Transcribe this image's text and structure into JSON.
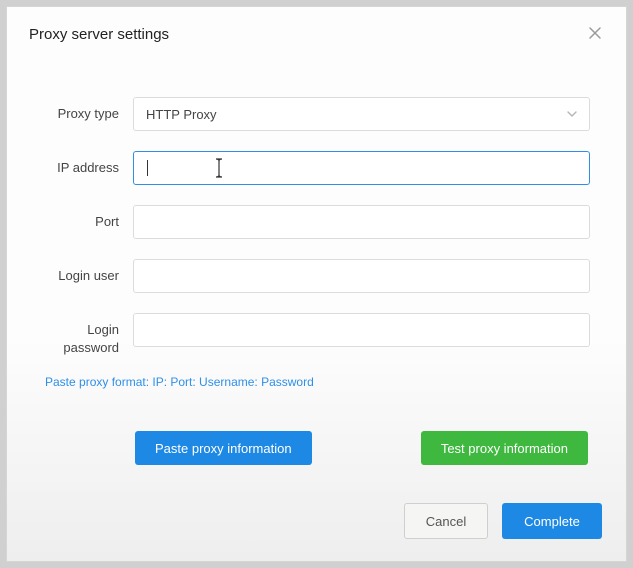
{
  "dialog": {
    "title": "Proxy server settings"
  },
  "form": {
    "proxyType": {
      "label": "Proxy type",
      "selected": "HTTP Proxy"
    },
    "ipAddress": {
      "label": "IP address",
      "value": ""
    },
    "port": {
      "label": "Port",
      "value": ""
    },
    "loginUser": {
      "label": "Login user",
      "value": ""
    },
    "loginPassword": {
      "label": "Login password",
      "value": ""
    },
    "hint": "Paste proxy format: IP: Port: Username: Password"
  },
  "actions": {
    "paste": "Paste proxy information",
    "test": "Test proxy information"
  },
  "footer": {
    "cancel": "Cancel",
    "complete": "Complete"
  }
}
